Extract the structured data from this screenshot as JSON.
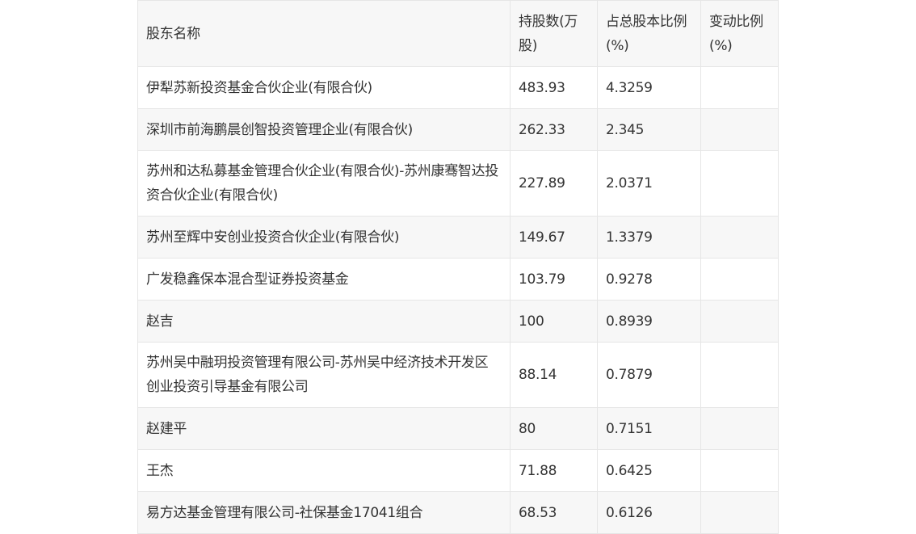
{
  "table": {
    "headers": [
      "股东名称",
      "持股数(万股)",
      "占总股本比例(%)",
      "变动比例(%)"
    ],
    "rows": [
      {
        "name": "伊犁苏新投资基金合伙企业(有限合伙)",
        "shares": "483.93",
        "ratio": "4.3259",
        "change": ""
      },
      {
        "name": "深圳市前海鹏晨创智投资管理企业(有限合伙)",
        "shares": "262.33",
        "ratio": "2.345",
        "change": ""
      },
      {
        "name": "苏州和达私募基金管理合伙企业(有限合伙)-苏州康骞智达投资合伙企业(有限合伙)",
        "shares": "227.89",
        "ratio": "2.0371",
        "change": ""
      },
      {
        "name": "苏州至辉中安创业投资合伙企业(有限合伙)",
        "shares": "149.67",
        "ratio": "1.3379",
        "change": ""
      },
      {
        "name": "广发稳鑫保本混合型证券投资基金",
        "shares": "103.79",
        "ratio": "0.9278",
        "change": ""
      },
      {
        "name": "赵吉",
        "shares": "100",
        "ratio": "0.8939",
        "change": ""
      },
      {
        "name": "苏州吴中融玥投资管理有限公司-苏州吴中经济技术开发区创业投资引导基金有限公司",
        "shares": "88.14",
        "ratio": "0.7879",
        "change": ""
      },
      {
        "name": "赵建平",
        "shares": "80",
        "ratio": "0.7151",
        "change": ""
      },
      {
        "name": "王杰",
        "shares": "71.88",
        "ratio": "0.6425",
        "change": ""
      },
      {
        "name": "易方达基金管理有限公司-社保基金17041组合",
        "shares": "68.53",
        "ratio": "0.6126",
        "change": ""
      }
    ]
  }
}
